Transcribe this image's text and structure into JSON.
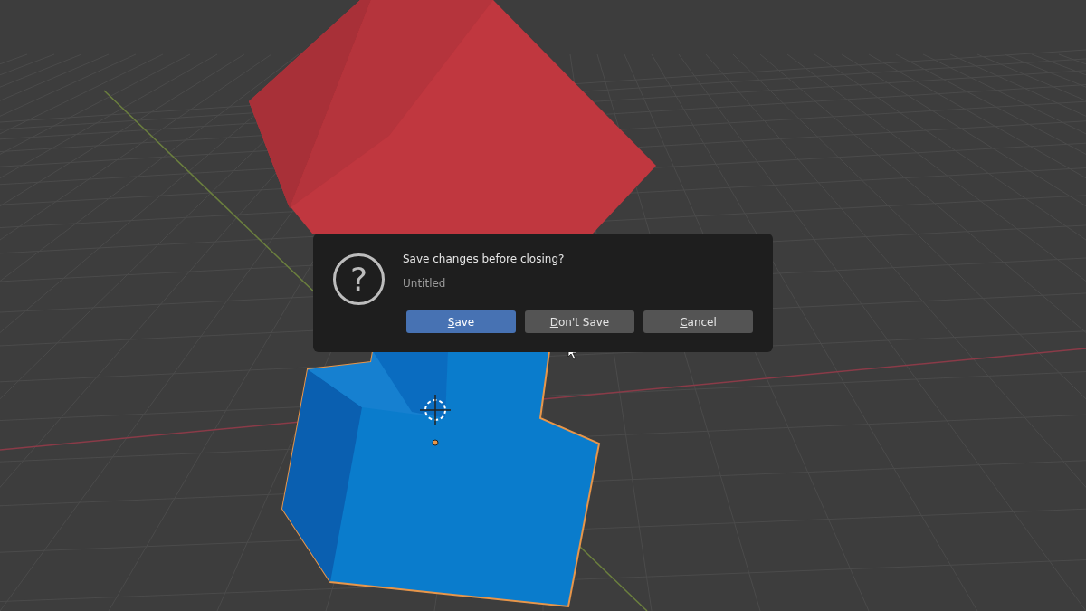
{
  "dialog": {
    "icon_glyph": "?",
    "title": "Save changes before closing?",
    "subtitle": "Untitled",
    "buttons": [
      {
        "label": "Save",
        "kind": "primary"
      },
      {
        "label": "Don't Save",
        "kind": "default"
      },
      {
        "label": "Cancel",
        "kind": "default"
      }
    ]
  }
}
